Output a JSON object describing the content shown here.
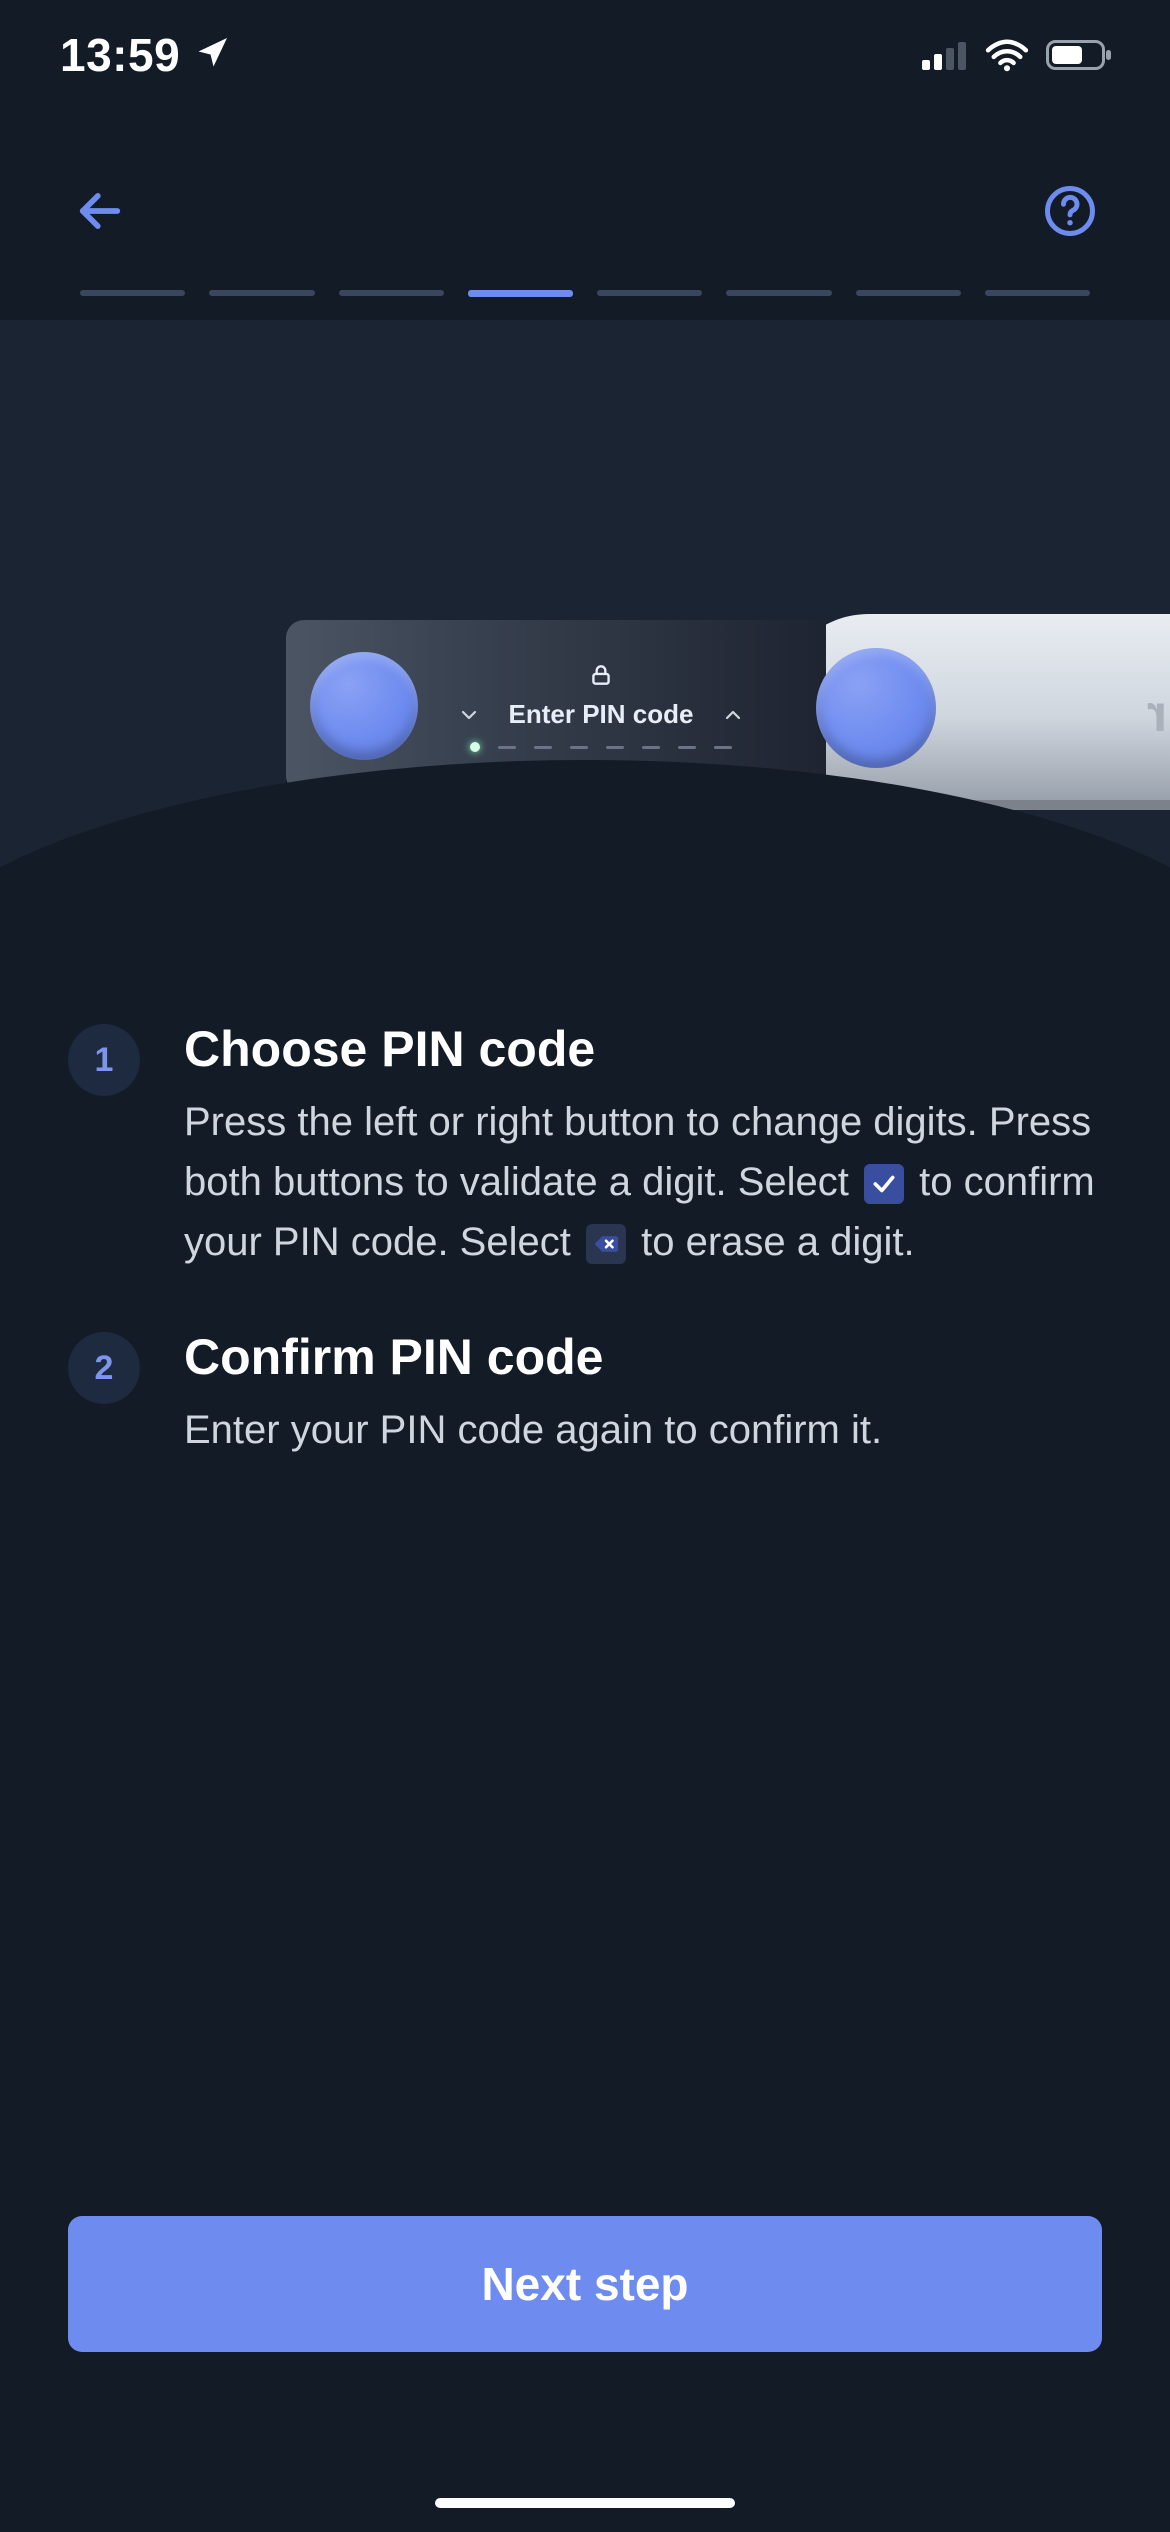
{
  "status": {
    "time": "13:59"
  },
  "device_screen": {
    "title": "Enter PIN code"
  },
  "brand": "ger",
  "progress": {
    "total": 8,
    "active_index": 3
  },
  "steps": [
    {
      "num": "1",
      "title": "Choose PIN code",
      "desc_a": "Press the left or right button to change digits. Press both buttons to validate a digit. Select ",
      "desc_b": " to confirm your PIN code. Select ",
      "desc_c": " to erase a digit."
    },
    {
      "num": "2",
      "title": "Confirm PIN code",
      "desc": "Enter your PIN code again to confirm it."
    }
  ],
  "cta": {
    "label": "Next step"
  }
}
